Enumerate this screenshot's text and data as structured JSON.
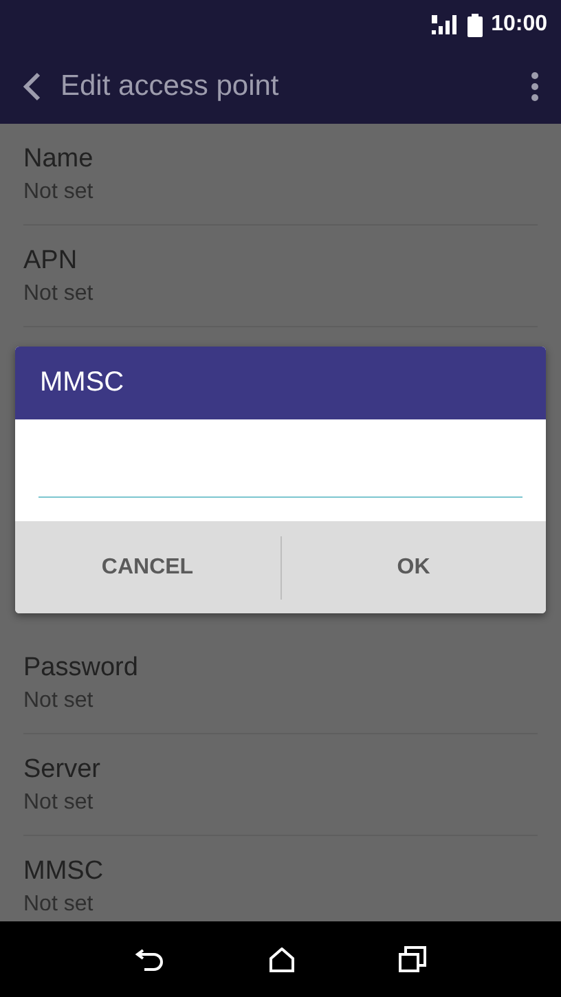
{
  "status_bar": {
    "time": "10:00"
  },
  "app_bar": {
    "title": "Edit access point"
  },
  "settings": [
    {
      "label": "Name",
      "value": "Not set"
    },
    {
      "label": "APN",
      "value": "Not set"
    },
    {
      "label": "Password",
      "value": "Not set"
    },
    {
      "label": "Server",
      "value": "Not set"
    },
    {
      "label": "MMSC",
      "value": "Not set"
    }
  ],
  "dialog": {
    "title": "MMSC",
    "buttons": [
      "CANCEL",
      "OK"
    ]
  }
}
